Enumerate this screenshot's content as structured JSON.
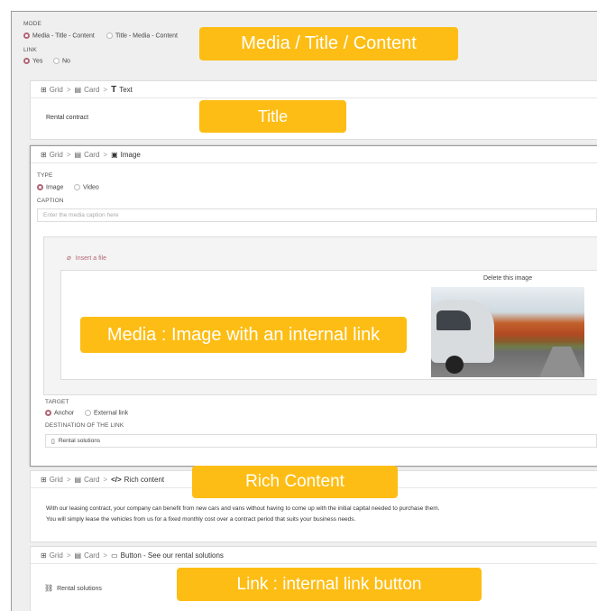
{
  "mode": {
    "label": "MODE",
    "options": [
      "Media - Title - Content",
      "Title - Media - Content"
    ],
    "selected": 0
  },
  "link": {
    "label": "LINK",
    "options": [
      "Yes",
      "No"
    ],
    "selected": 0
  },
  "breadcrumbs": {
    "grid": "Grid",
    "card": "Card",
    "text": "Text",
    "image": "Image",
    "rich": "Rich content",
    "button": "Button - See our rental solutions"
  },
  "text_panel": {
    "value": "Rental contract"
  },
  "image_panel": {
    "type_label": "TYPE",
    "type_options": [
      "Image",
      "Video"
    ],
    "caption_label": "CAPTION",
    "caption_placeholder": "Enter the media caption here",
    "insert_file": "Insert a file",
    "delete_image": "Delete this image",
    "target_label": "TARGET",
    "target_options": [
      "Anchor",
      "External link"
    ],
    "destination_label": "DESTINATION OF THE LINK",
    "destination_value": "Rental solutions"
  },
  "rich_panel": {
    "line1": "With our leasing contract, your company can benefit from new cars and vans without having to come up with the initial capital needed to purchase them.",
    "line2": "You will simply lease the vehicles from us for a fixed monthly cost over a contract period that suits your business needs."
  },
  "button_panel": {
    "link_text": "Rental solutions"
  },
  "callouts": {
    "mode": "Media / Title / Content",
    "title": "Title",
    "media": "Media : Image with an internal link",
    "rich": "Rich Content",
    "link": "Link : internal link button"
  },
  "colors": {
    "callout": "#fdbd14",
    "radio_selected": "#b06575"
  }
}
